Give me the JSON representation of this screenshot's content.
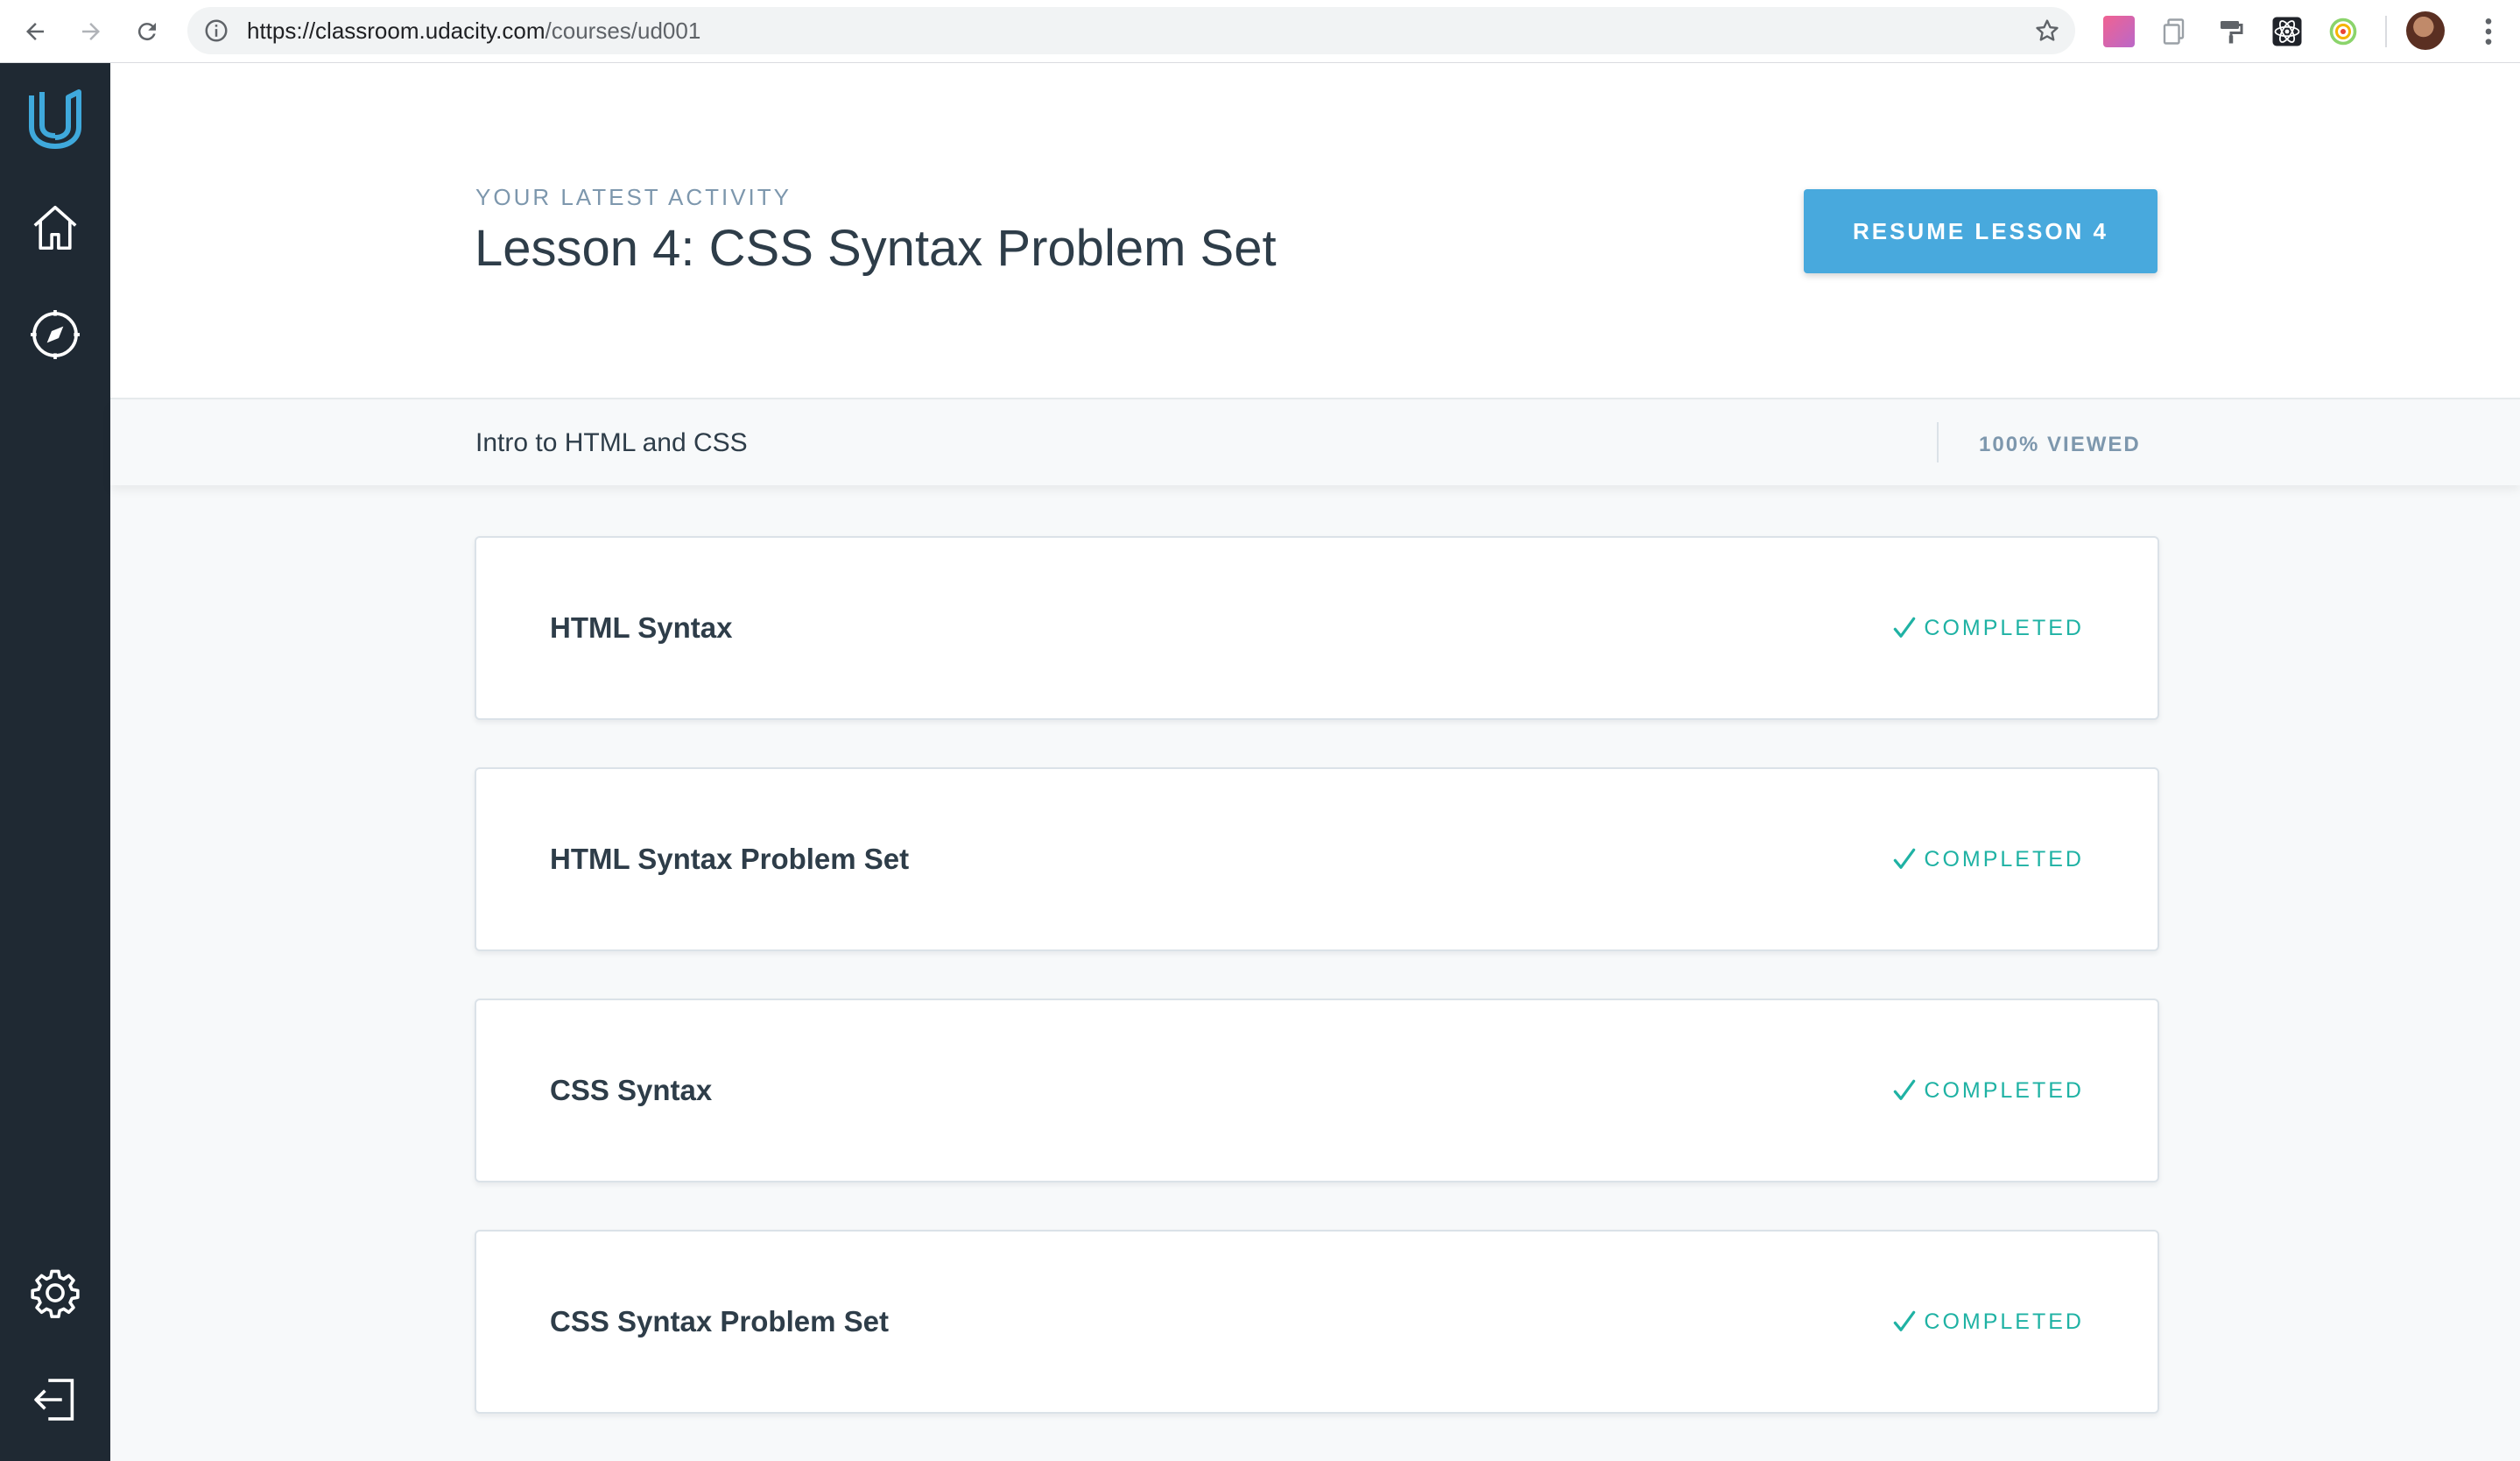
{
  "browser": {
    "url_host": "https://classroom.udacity.com",
    "url_path": "/courses/ud001"
  },
  "rail": {
    "items": [
      {
        "name": "udacity-logo-icon"
      },
      {
        "name": "home-icon"
      },
      {
        "name": "compass-icon"
      },
      {
        "name": "gear-icon"
      },
      {
        "name": "logout-icon"
      }
    ]
  },
  "header": {
    "kicker": "YOUR LATEST ACTIVITY",
    "title": "Lesson 4: CSS Syntax Problem Set",
    "resume_label": "RESUME LESSON 4"
  },
  "subbar": {
    "course_name": "Intro to HTML and CSS",
    "viewed": "100% VIEWED"
  },
  "lessons": [
    {
      "title": "HTML Syntax",
      "status": "COMPLETED"
    },
    {
      "title": "HTML Syntax Problem Set",
      "status": "COMPLETED"
    },
    {
      "title": "CSS Syntax",
      "status": "COMPLETED"
    },
    {
      "title": "CSS Syntax Problem Set",
      "status": "COMPLETED"
    }
  ],
  "colors": {
    "rail": "#1f2933",
    "accent": "#48a9dd",
    "completed": "#1fb2a4"
  }
}
